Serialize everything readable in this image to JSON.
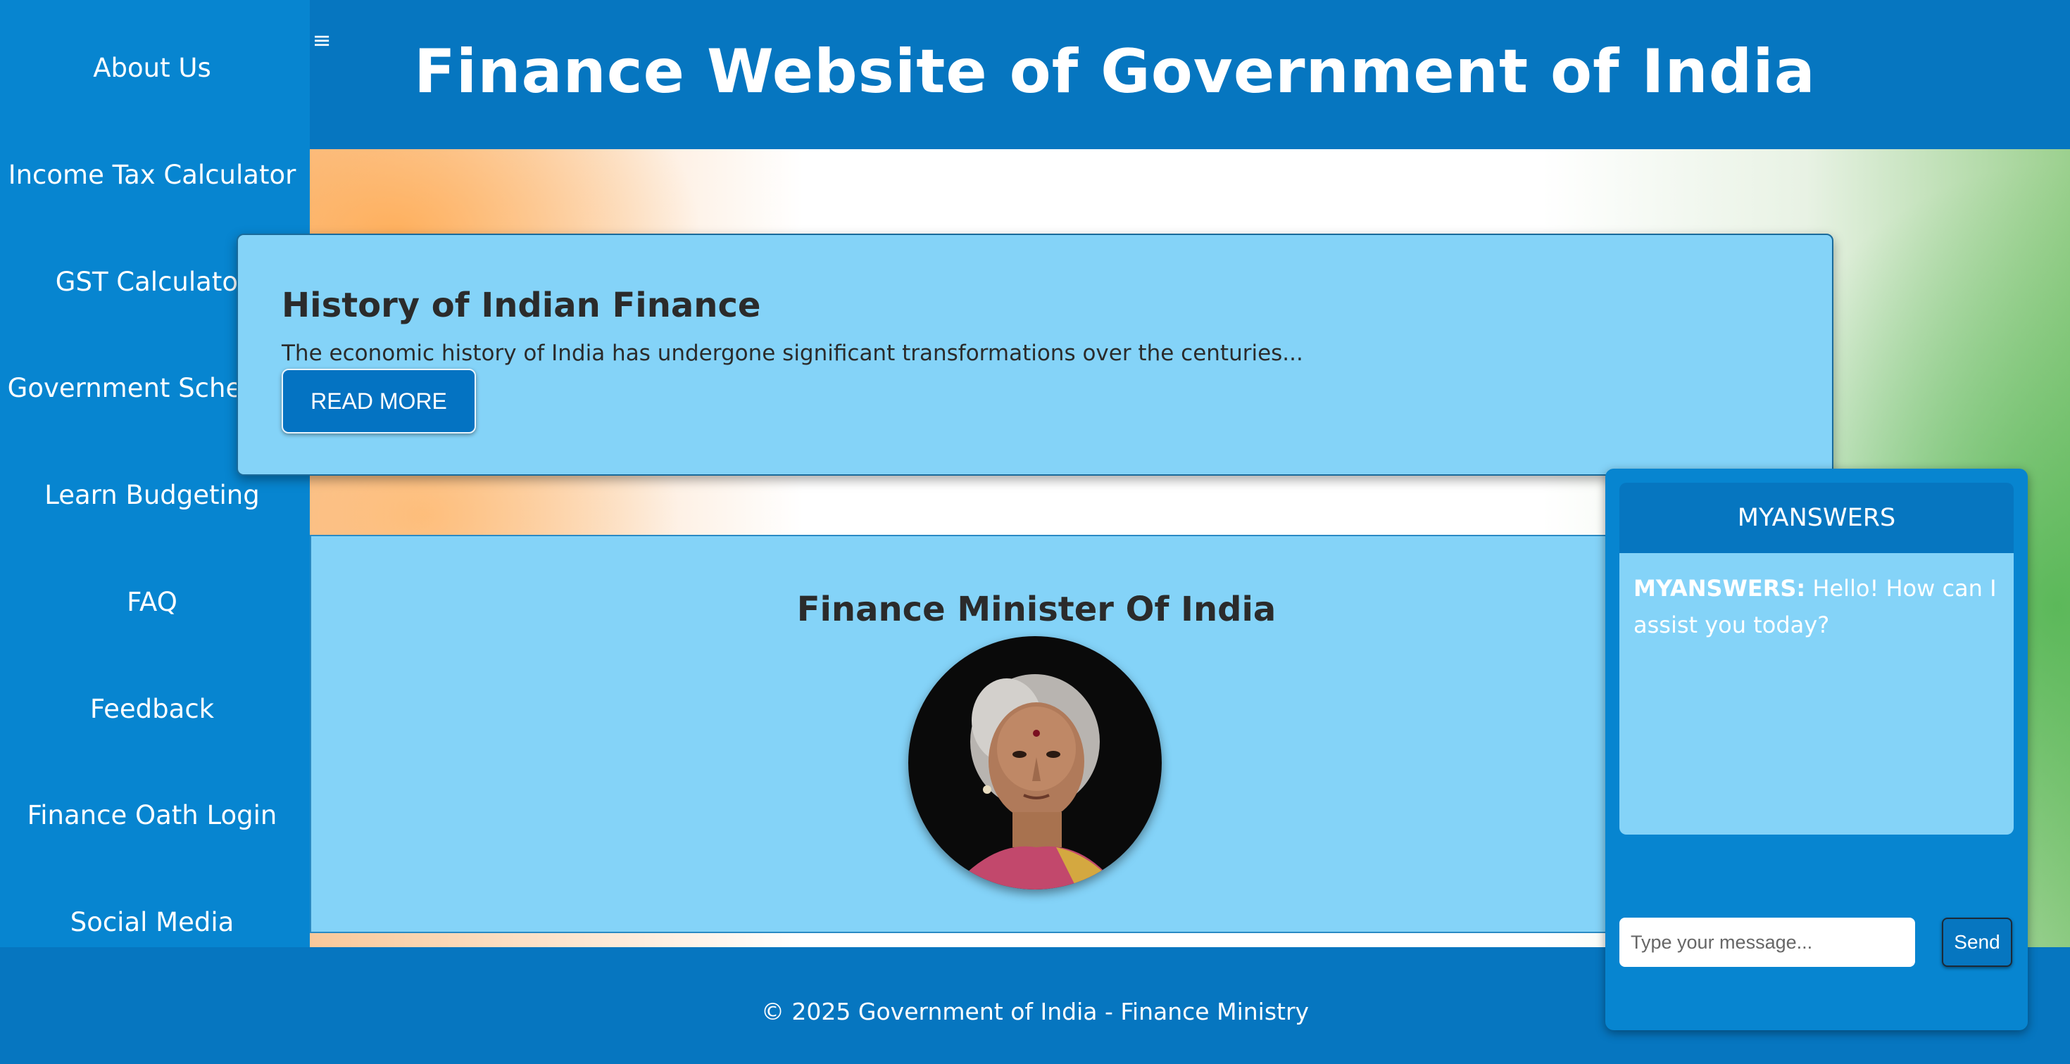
{
  "header": {
    "menu_icon": "hamburger-menu-icon",
    "title": "Finance Website of Government of India"
  },
  "sidebar": {
    "items": [
      {
        "label": "About Us"
      },
      {
        "label": "Income Tax Calculator"
      },
      {
        "label": "GST Calculator"
      },
      {
        "label": "Government Schemes"
      },
      {
        "label": "Learn Budgeting"
      },
      {
        "label": "FAQ"
      },
      {
        "label": "Feedback"
      },
      {
        "label": "Finance Oath Login"
      },
      {
        "label": "Social Media"
      }
    ]
  },
  "history": {
    "title": "History of Indian Finance",
    "text": "The economic history of India has undergone significant transformations over the centuries...",
    "button_label": "READ MORE"
  },
  "minister": {
    "title": "Finance Minister Of India"
  },
  "chat": {
    "title": "MYANSWERS",
    "messages": [
      {
        "sender": "MYANSWERS:",
        "text": "Hello! How can I assist you today?"
      }
    ],
    "input_placeholder": "Type your message...",
    "send_label": "Send"
  },
  "footer": {
    "text": "© 2025 Government of India - Finance Ministry"
  },
  "colors": {
    "primary": "#0676c0",
    "sidebar": "#0785d0",
    "card": "#84d3f8"
  }
}
